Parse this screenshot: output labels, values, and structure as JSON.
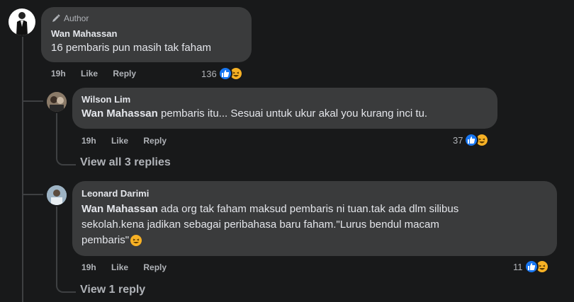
{
  "comment_main": {
    "badge": "Author",
    "author": "Wan Mahassan",
    "text": "16 pembaris pun masih tak faham",
    "time": "19h",
    "like_label": "Like",
    "reply_label": "Reply",
    "reaction_count": "136"
  },
  "reply1": {
    "author": "Wilson Lim",
    "mention": "Wan Mahassan",
    "text": " pembaris itu... Sesuai untuk ukur akal you kurang inci tu.",
    "time": "19h",
    "like_label": "Like",
    "reply_label": "Reply",
    "reaction_count": "37",
    "view_replies": "View all 3 replies"
  },
  "reply2": {
    "author": "Leonard Darimi",
    "mention": "Wan Mahassan",
    "text_line1": " ada org tak faham maksud pembaris ni tuan.tak ada dlm silibus",
    "text_line2": "sekolah.kena jadikan sebagai peribahasa baru faham.\"Lurus bendul macam",
    "text_line3": "pembaris\"",
    "time": "19h",
    "like_label": "Like",
    "reply_label": "Reply",
    "reaction_count": "11",
    "view_replies": "View 1 reply"
  },
  "colors": {
    "background": "#18191a",
    "bubble": "#3a3b3c",
    "like_blue": "#1877f2",
    "haha_yellow": "#f7b125",
    "muted_text": "#b0b3b8"
  }
}
